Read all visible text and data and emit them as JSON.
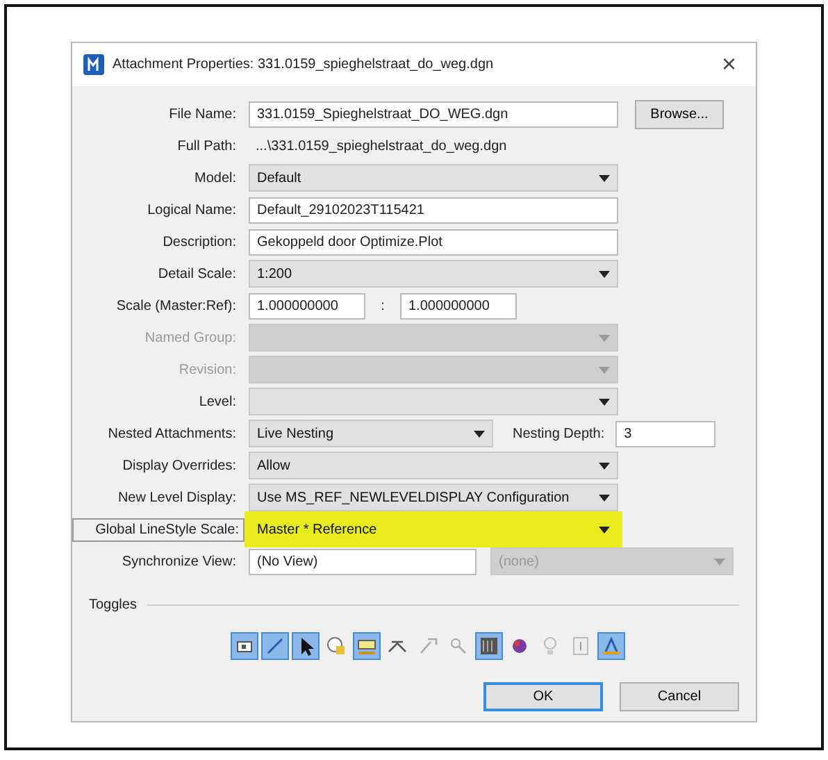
{
  "window": {
    "title": "Attachment Properties: 331.0159_spieghelstraat_do_weg.dgn",
    "close": "×"
  },
  "rows": [
    {
      "kind": "input",
      "label": "File Name:",
      "value": "331.0159_Spieghelstraat_DO_WEG.dgn",
      "button": "Browse..."
    },
    {
      "kind": "static",
      "label": "Full Path:",
      "value": "...\\331.0159_spieghelstraat_do_weg.dgn"
    },
    {
      "kind": "dropdown",
      "label": "Model:",
      "value": "Default",
      "disabled": false,
      "highlighted": false
    },
    {
      "kind": "input",
      "label": "Logical Name:",
      "value": "Default_29102023T115421"
    },
    {
      "kind": "input",
      "label": "Description:",
      "value": "Gekoppeld door Optimize.Plot"
    },
    {
      "kind": "dropdown",
      "label": "Detail Scale:",
      "value": "1:200",
      "disabled": false,
      "highlighted": false
    },
    {
      "kind": "scale",
      "label": "Scale (Master:Ref):",
      "value": "1.000000000",
      "separator": ":",
      "value2": "1.000000000"
    },
    {
      "kind": "dropdown",
      "label": "Named Group:",
      "disabled": true,
      "highlighted": false
    },
    {
      "kind": "dropdown",
      "label": "Revision:",
      "disabled": true,
      "highlighted": false
    },
    {
      "kind": "dropdown",
      "label": "Level:",
      "disabled": false,
      "highlighted": false
    },
    {
      "kind": "nested",
      "label": "Nested Attachments:",
      "value": "Live Nesting",
      "label2": "Nesting Depth:",
      "value2": "3"
    },
    {
      "kind": "dropdown",
      "label": "Display Overrides:",
      "value": "Allow",
      "disabled": false,
      "highlighted": false
    },
    {
      "kind": "dropdown",
      "label": "New Level Display:",
      "value": "Use MS_REF_NEWLEVELDISPLAY Configuration",
      "disabled": false,
      "highlighted": false
    },
    {
      "kind": "dropdown",
      "label": "Global LineStyle Scale:",
      "value": "Master * Reference",
      "disabled": false,
      "highlighted": true
    },
    {
      "kind": "sync",
      "label": "Synchronize View:",
      "value": "(No View)",
      "value2": "(none)"
    }
  ],
  "toggles": {
    "title": "Toggles",
    "items": [
      {
        "on": true
      },
      {
        "on": true
      },
      {
        "on": true
      },
      {
        "on": false
      },
      {
        "on": true
      },
      {
        "on": false
      },
      {
        "on": false
      },
      {
        "on": false
      },
      {
        "on": true
      },
      {
        "on": false
      },
      {
        "on": false
      },
      {
        "on": false
      },
      {
        "on": true
      }
    ]
  },
  "buttons": [
    {
      "label": "OK",
      "default": true
    },
    {
      "label": "Cancel",
      "default": false
    }
  ]
}
